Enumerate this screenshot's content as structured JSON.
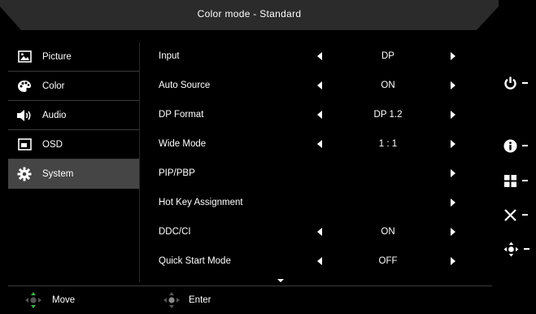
{
  "header": {
    "title": "Color mode - Standard"
  },
  "menu": [
    {
      "label": "Picture",
      "icon": "picture-icon",
      "selected": false
    },
    {
      "label": "Color",
      "icon": "palette-icon",
      "selected": false
    },
    {
      "label": "Audio",
      "icon": "speaker-icon",
      "selected": false
    },
    {
      "label": "OSD",
      "icon": "osd-window-icon",
      "selected": false
    },
    {
      "label": "System",
      "icon": "gear-icon",
      "selected": true
    }
  ],
  "settings": [
    {
      "label": "Input",
      "value": "DP",
      "left_arrow": true,
      "right_arrow": true
    },
    {
      "label": "Auto Source",
      "value": "ON",
      "left_arrow": true,
      "right_arrow": true
    },
    {
      "label": "DP Format",
      "value": "DP 1.2",
      "left_arrow": true,
      "right_arrow": true
    },
    {
      "label": "Wide Mode",
      "value": "1 : 1",
      "left_arrow": true,
      "right_arrow": true
    },
    {
      "label": "PIP/PBP",
      "value": "",
      "left_arrow": false,
      "right_arrow": true
    },
    {
      "label": "Hot Key Assignment",
      "value": "",
      "left_arrow": false,
      "right_arrow": true
    },
    {
      "label": "DDC/CI",
      "value": "ON",
      "left_arrow": true,
      "right_arrow": true
    },
    {
      "label": "Quick Start Mode",
      "value": "OFF",
      "left_arrow": true,
      "right_arrow": true
    }
  ],
  "footer": {
    "move_label": "Move",
    "enter_label": "Enter"
  },
  "side_buttons": [
    "power-icon",
    "info-icon",
    "menu-grid-icon",
    "close-icon",
    "joystick-icon"
  ],
  "colors": {
    "background": "#000000",
    "selected": "#454545",
    "move_accent": "#3db34a"
  }
}
